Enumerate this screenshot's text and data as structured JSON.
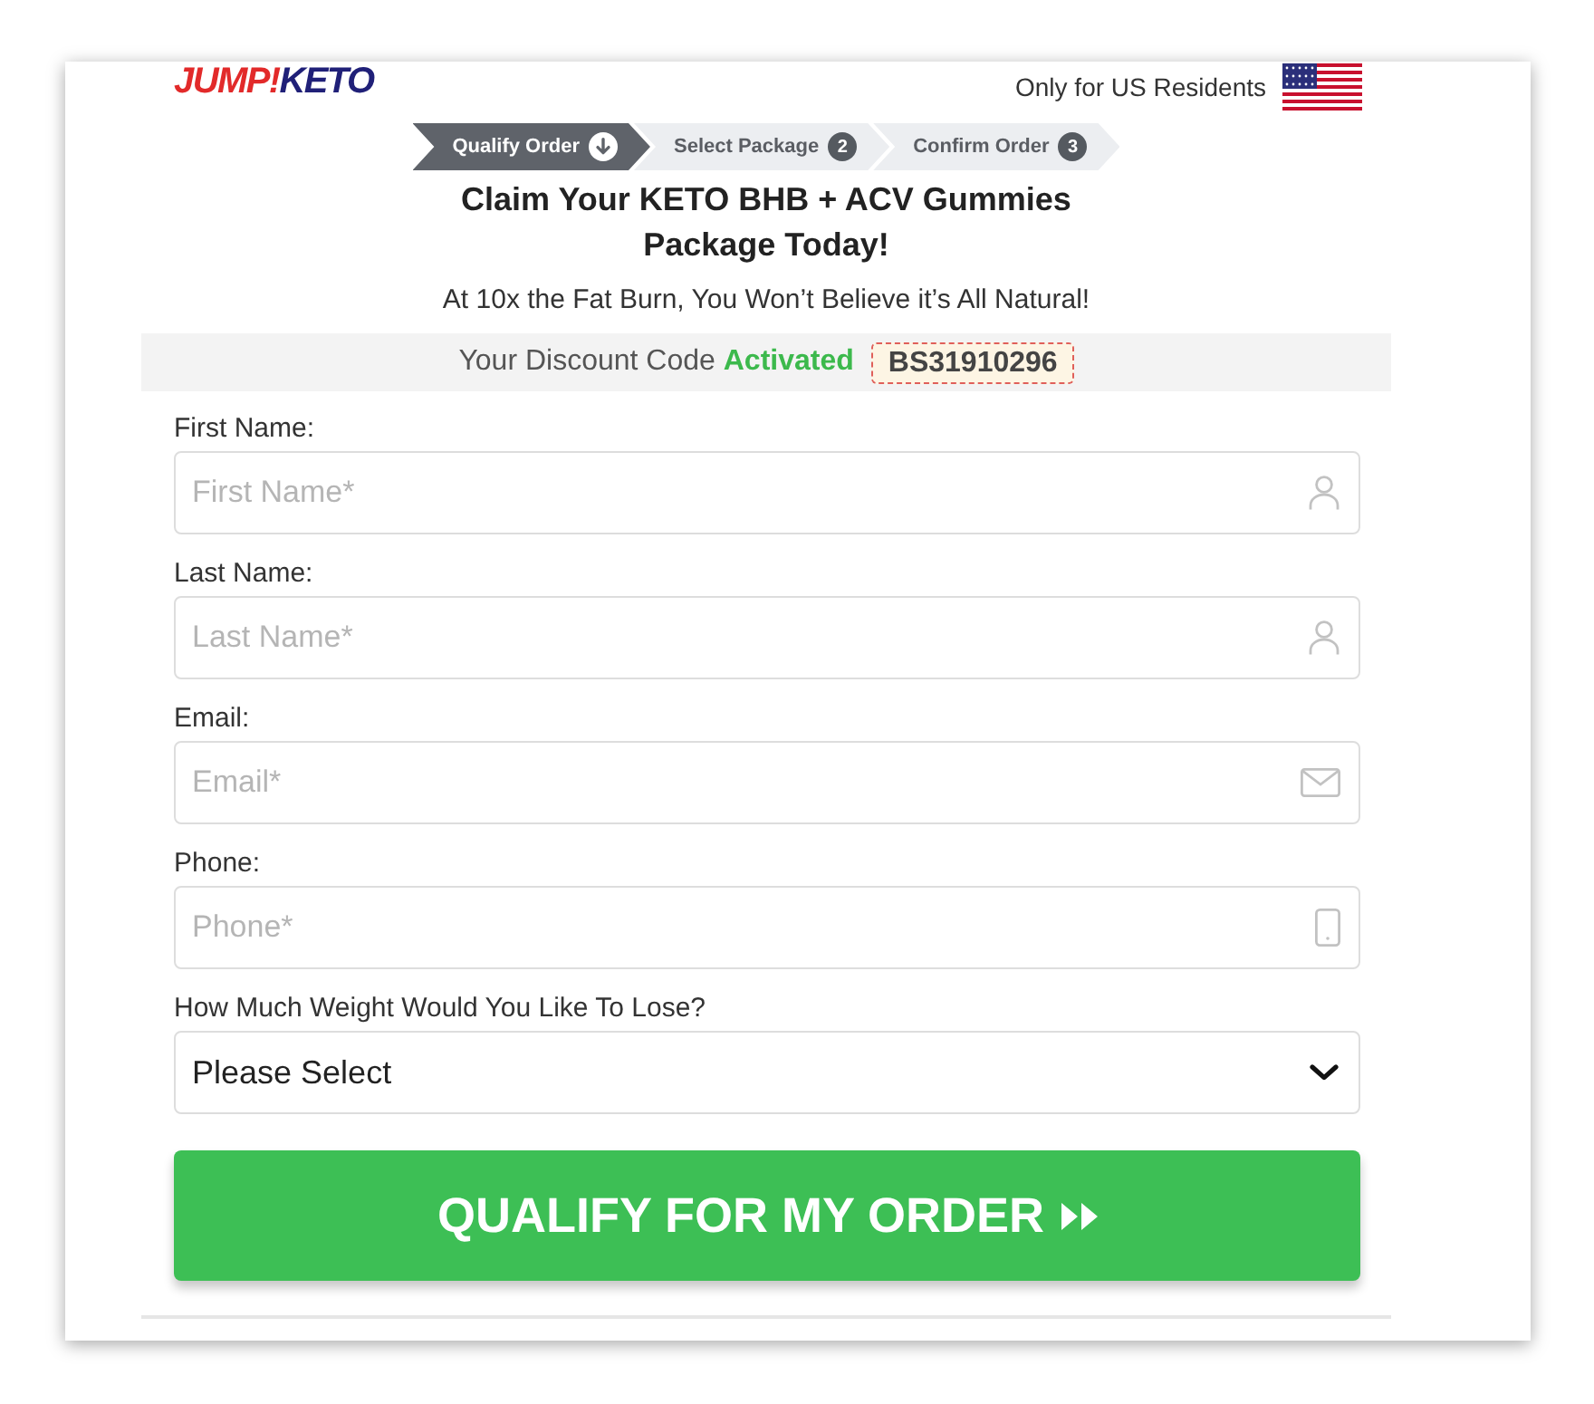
{
  "header": {
    "logo": [
      "JUMP!",
      "KETO"
    ],
    "residency_note": "Only for US Residents"
  },
  "steps": [
    {
      "label": "Qualify Order",
      "selected": true
    },
    {
      "label": "Select Package",
      "number": "2",
      "selected": false
    },
    {
      "label": "Confirm Order",
      "number": "3",
      "selected": false
    }
  ],
  "headline": "Claim Your KETO BHB + ACV Gummies Package Today!",
  "subheadline": "At 10x the Fat Burn, You Won’t Believe it’s All Natural!",
  "discount": {
    "message": "Your Discount Code **Activated**",
    "code": "BS31910296"
  },
  "form": {
    "fields": [
      {
        "kind": "name",
        "label": "First Name:",
        "placeholder": "First Name*"
      },
      {
        "kind": "name",
        "label": "Last Name:",
        "placeholder": "Last Name*"
      },
      {
        "kind": "email",
        "label": "Email:",
        "placeholder": "Email*"
      },
      {
        "kind": "phone",
        "label": "Phone:",
        "placeholder": "Phone*"
      },
      {
        "kind": "select",
        "label": "How Much Weight Would You Like To Lose?",
        "value": "Please Select"
      }
    ],
    "submit": "QUALIFY FOR MY ORDER"
  }
}
